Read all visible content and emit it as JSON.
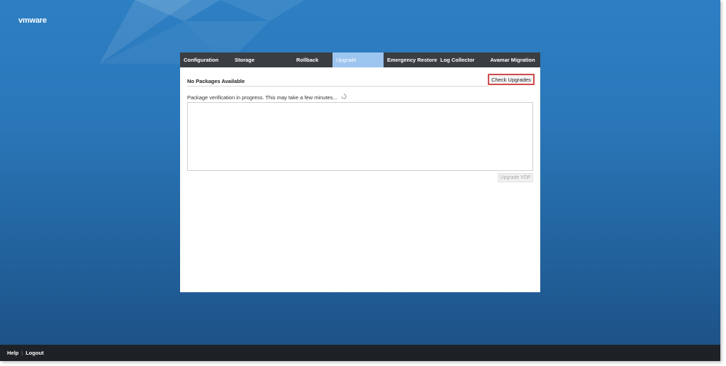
{
  "brand": {
    "logo_text": "vmware"
  },
  "tabs": [
    {
      "label": "Configuration",
      "active": false
    },
    {
      "label": "Storage",
      "active": false
    },
    {
      "label": "Rollback",
      "active": false
    },
    {
      "label": "Upgrade",
      "active": true
    },
    {
      "label": "Emergency Restore",
      "active": false
    },
    {
      "label": "Log Collector",
      "active": false
    },
    {
      "label": "Avamar Migration",
      "active": false
    }
  ],
  "upgrade": {
    "packages_status": "No Packages Available",
    "check_button": "Check Upgrades",
    "verification_text": "Package verification in progress. This may take a few minutes...",
    "upgrade_button": "Upgrade VDP"
  },
  "footer": {
    "help": "Help",
    "separator": "|",
    "logout": "Logout"
  },
  "colors": {
    "background_top": "#2d7fc3",
    "background_bottom": "#1d4f83",
    "tab_bar": "#3a3d42",
    "active_tab": "#9cc5f0",
    "highlight_border": "#d24a4a",
    "footer": "#1e2226"
  },
  "icons": {
    "spinner": "loading-spinner-icon"
  }
}
